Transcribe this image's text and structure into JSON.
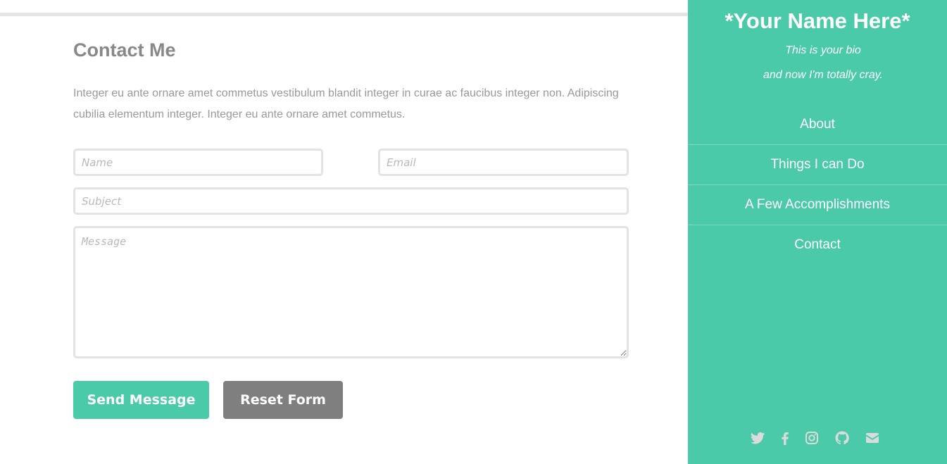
{
  "page": {
    "section_title": "Contact Me",
    "intro": "Integer eu ante ornare amet commetus vestibulum blandit integer in curae ac faucibus integer non. Adipiscing cubilia elementum integer. Integer eu ante ornare amet commetus."
  },
  "form": {
    "name_placeholder": "Name",
    "email_placeholder": "Email",
    "subject_placeholder": "Subject",
    "message_placeholder": "Message",
    "send_label": "Send Message",
    "reset_label": "Reset Form"
  },
  "sidebar": {
    "name": "*Your Name Here*",
    "bio_line1": "This is your bio",
    "bio_line2": "and now I'm totally cray.",
    "nav": [
      {
        "label": "About"
      },
      {
        "label": "Things I can Do"
      },
      {
        "label": "A Few Accomplishments"
      },
      {
        "label": "Contact"
      }
    ],
    "social_icons": [
      "twitter-icon",
      "facebook-icon",
      "instagram-icon",
      "github-icon",
      "envelope-icon"
    ]
  },
  "colors": {
    "accent": "#4acaa8",
    "reset_button": "#7f7f7f",
    "heading_text": "#888888",
    "body_text": "#999999",
    "social_icon": "#d9dcdb"
  }
}
